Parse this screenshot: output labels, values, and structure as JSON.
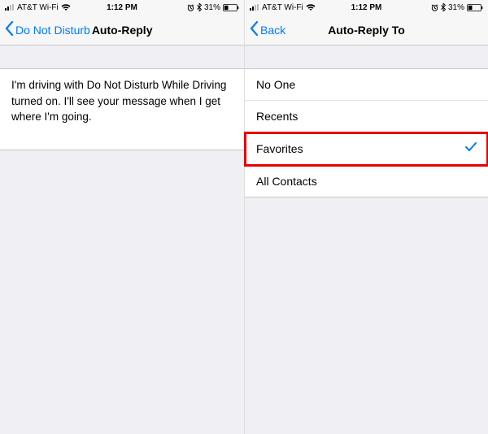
{
  "status": {
    "carrier": "AT&T Wi-Fi",
    "time": "1:12 PM",
    "battery_pct": "31%"
  },
  "left": {
    "back_label": "Do Not Disturb",
    "title": "Auto-Reply",
    "message": "I'm driving with Do Not Disturb While Driving turned on. I'll see your message when I get where I'm going."
  },
  "right": {
    "back_label": "Back",
    "title": "Auto-Reply To",
    "options": {
      "no_one": "No One",
      "recents": "Recents",
      "favorites": "Favorites",
      "all_contacts": "All Contacts"
    },
    "selected": "favorites"
  }
}
